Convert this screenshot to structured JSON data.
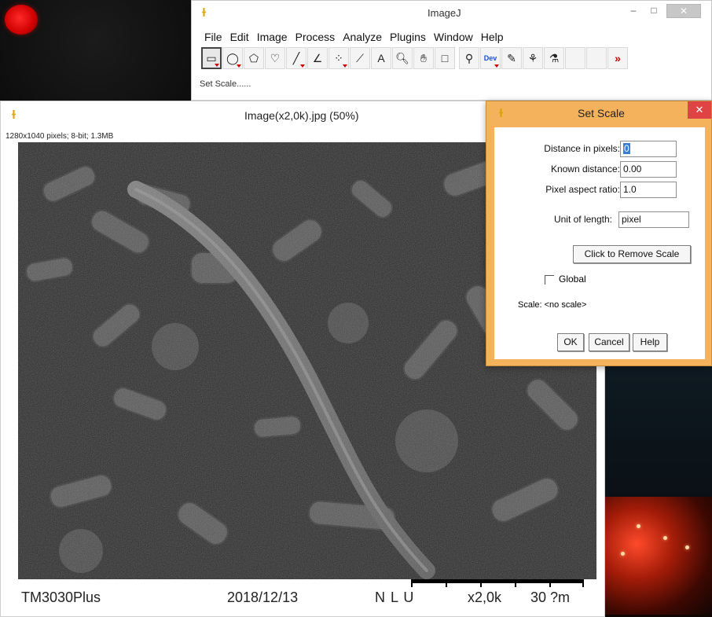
{
  "main_window": {
    "title": "ImageJ",
    "menus": [
      "File",
      "Edit",
      "Image",
      "Process",
      "Analyze",
      "Plugins",
      "Window",
      "Help"
    ],
    "tools": [
      {
        "name": "rectangle-tool-icon",
        "glyph": "▭",
        "active": true,
        "dropdown": true
      },
      {
        "name": "oval-tool-icon",
        "glyph": "◯",
        "dropdown": true
      },
      {
        "name": "polygon-tool-icon",
        "glyph": "⬠",
        "dropdown": false
      },
      {
        "name": "freehand-tool-icon",
        "glyph": "♡",
        "dropdown": false
      },
      {
        "name": "line-tool-icon",
        "glyph": "╱",
        "dropdown": true
      },
      {
        "name": "angle-tool-icon",
        "glyph": "∠",
        "dropdown": false
      },
      {
        "name": "point-tool-icon",
        "glyph": "⁘",
        "dropdown": true
      },
      {
        "name": "wand-tool-icon",
        "glyph": "⟋",
        "dropdown": false
      },
      {
        "name": "text-tool-icon",
        "glyph": "A",
        "dropdown": false
      },
      {
        "name": "magnifier-tool-icon",
        "glyph": "🔍︎",
        "dropdown": false
      },
      {
        "name": "hand-tool-icon",
        "glyph": "✋︎",
        "dropdown": false
      },
      {
        "name": "color-picker-tool-icon",
        "glyph": "□",
        "dropdown": false
      },
      {
        "name": "zoom-tool-icon",
        "glyph": "⚲",
        "dropdown": false,
        "gap": true
      },
      {
        "name": "dev-tool-icon",
        "glyph": "Dev",
        "dropdown": true
      },
      {
        "name": "pencil-tool-icon",
        "glyph": "✎",
        "dropdown": false
      },
      {
        "name": "brush-tool-icon",
        "glyph": "⚘",
        "dropdown": false
      },
      {
        "name": "flood-fill-tool-icon",
        "glyph": "⚗",
        "dropdown": false
      },
      {
        "name": "empty-tool-slot-icon",
        "glyph": "",
        "dropdown": false
      },
      {
        "name": "empty-tool-slot-icon",
        "glyph": "",
        "dropdown": false
      },
      {
        "name": "more-tools-icon",
        "glyph": "»",
        "dropdown": false
      }
    ],
    "status": "Set Scale......",
    "window_controls": {
      "minimize": "–",
      "maximize": "□",
      "close": "✕"
    }
  },
  "image_window": {
    "title": "Image(x2,0k).jpg (50%)",
    "info": "1280x1040 pixels; 8-bit; 1.3MB",
    "footer": {
      "model": "TM3030Plus",
      "date": "2018/12/13",
      "mode": "N L U",
      "magnification": "x2,0k",
      "scale": "30 ?m"
    }
  },
  "set_scale_dialog": {
    "title": "Set Scale",
    "close": "✕",
    "fields": [
      {
        "label": "Distance in pixels:",
        "value": "0"
      },
      {
        "label": "Known distance:",
        "value": "0.00"
      },
      {
        "label": "Pixel aspect ratio:",
        "value": "1.0"
      },
      {
        "label": "Unit of length:",
        "value": "pixel"
      }
    ],
    "remove_scale_button": "Click to Remove Scale",
    "global_label": "Global",
    "global_checked": false,
    "scale_text": "Scale: <no scale>",
    "buttons": {
      "ok": "OK",
      "cancel": "Cancel",
      "help": "Help"
    }
  },
  "colors": {
    "dialog_border": "#f4b25c",
    "close_red": "#e04343",
    "selection_blue": "#3b7ed6"
  }
}
